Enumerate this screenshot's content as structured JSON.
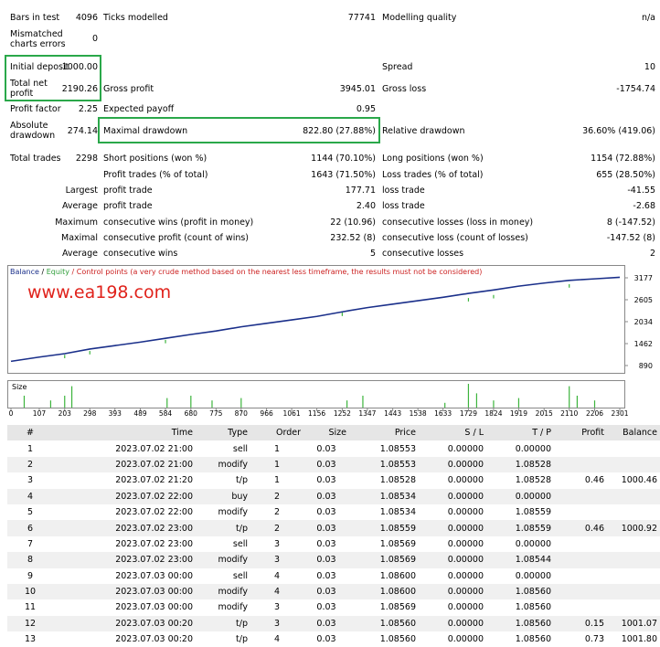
{
  "summary": {
    "bars_in_test_label": "Bars in test",
    "bars_in_test": "4096",
    "ticks_modelled_label": "Ticks modelled",
    "ticks_modelled": "77741",
    "modelling_quality_label": "Modelling quality",
    "modelling_quality": "n/a",
    "mismatched_label_1": "Mismatched",
    "mismatched_label_2": "charts errors",
    "mismatched": "0",
    "initial_deposit_label": "Initial deposit",
    "initial_deposit": "1000.00",
    "spread_label": "Spread",
    "spread": "10",
    "total_net_label_1": "Total net",
    "total_net_label_2": "profit",
    "total_net": "2190.26",
    "gross_profit_label": "Gross profit",
    "gross_profit": "3945.01",
    "gross_loss_label": "Gross loss",
    "gross_loss": "-1754.74",
    "profit_factor_label": "Profit factor",
    "profit_factor": "2.25",
    "expected_payoff_label": "Expected payoff",
    "expected_payoff": "0.95",
    "absolute_dd_label_1": "Absolute",
    "absolute_dd_label_2": "drawdown",
    "absolute_dd": "274.14",
    "maximal_dd_label": "Maximal drawdown",
    "maximal_dd": "822.80 (27.88%)",
    "relative_dd_label": "Relative drawdown",
    "relative_dd": "36.60% (419.06)",
    "total_trades_label": "Total trades",
    "total_trades": "2298",
    "short_label": "Short positions (won %)",
    "short": "1144 (70.10%)",
    "long_label": "Long positions (won %)",
    "long": "1154 (72.88%)",
    "profit_trades_label": "Profit trades (% of total)",
    "profit_trades": "1643 (71.50%)",
    "loss_trades_label": "Loss trades (% of total)",
    "loss_trades": "655 (28.50%)",
    "largest_label": "Largest",
    "largest_profit_label": "profit trade",
    "largest_profit": "177.71",
    "largest_loss_label": "loss trade",
    "largest_loss": "-41.55",
    "average_label": "Average",
    "average_profit_label": "profit trade",
    "average_profit": "2.40",
    "average_loss_label": "loss trade",
    "average_loss": "-2.68",
    "maximum_label": "Maximum",
    "max_cons_wins_label": "consecutive wins (profit in money)",
    "max_cons_wins": "22 (10.96)",
    "max_cons_losses_label": "consecutive losses (loss in money)",
    "max_cons_losses": "8 (-147.52)",
    "maximal_label": "Maximal",
    "max_cons_profit_label": "consecutive profit (count of wins)",
    "max_cons_profit": "232.52 (8)",
    "max_cons_loss_label": "consecutive loss (count of losses)",
    "max_cons_loss": "-147.52 (8)",
    "average2_label": "Average",
    "avg_cons_wins_label": "consecutive wins",
    "avg_cons_wins": "5",
    "avg_cons_losses_label": "consecutive losses",
    "avg_cons_losses": "2"
  },
  "watermark": "www.ea198.com",
  "chart_data": {
    "type": "line",
    "legend_balance": "Balance",
    "legend_sep1": " / ",
    "legend_equity": "Equity",
    "legend_rest": " / Control points (a very crude method based on the nearest less timeframe, the results must not be considered)",
    "size_label": "Size",
    "y_ticks": [
      "3177",
      "2605",
      "2034",
      "1462",
      "890"
    ],
    "y_values": [
      3177,
      2605,
      2034,
      1462,
      890
    ],
    "x_ticks": [
      "0",
      "107",
      "203",
      "298",
      "393",
      "489",
      "584",
      "680",
      "775",
      "870",
      "966",
      "1061",
      "1156",
      "1252",
      "1347",
      "1443",
      "1538",
      "1633",
      "1729",
      "1824",
      "1919",
      "2015",
      "2110",
      "2206",
      "2301"
    ],
    "x_values": [
      0,
      107,
      203,
      298,
      393,
      489,
      584,
      680,
      775,
      870,
      966,
      1061,
      1156,
      1252,
      1347,
      1443,
      1538,
      1633,
      1729,
      1824,
      1919,
      2015,
      2110,
      2206,
      2301
    ],
    "balance": [
      [
        0,
        1000
      ],
      [
        107,
        1110
      ],
      [
        203,
        1200
      ],
      [
        298,
        1320
      ],
      [
        393,
        1410
      ],
      [
        489,
        1500
      ],
      [
        584,
        1600
      ],
      [
        680,
        1700
      ],
      [
        775,
        1790
      ],
      [
        870,
        1900
      ],
      [
        966,
        1990
      ],
      [
        1061,
        2080
      ],
      [
        1156,
        2170
      ],
      [
        1252,
        2290
      ],
      [
        1347,
        2400
      ],
      [
        1443,
        2490
      ],
      [
        1538,
        2580
      ],
      [
        1633,
        2670
      ],
      [
        1729,
        2770
      ],
      [
        1824,
        2860
      ],
      [
        1919,
        2960
      ],
      [
        2015,
        3040
      ],
      [
        2110,
        3110
      ],
      [
        2206,
        3150
      ],
      [
        2301,
        3190
      ]
    ],
    "equity_dips": [
      [
        203,
        1080
      ],
      [
        298,
        1180
      ],
      [
        584,
        1470
      ],
      [
        1252,
        2180
      ],
      [
        1729,
        2560
      ],
      [
        1824,
        2640
      ],
      [
        2110,
        2920
      ]
    ],
    "size_bars": [
      [
        50,
        0.5
      ],
      [
        150,
        0.3
      ],
      [
        203,
        0.5
      ],
      [
        230,
        0.9
      ],
      [
        590,
        0.4
      ],
      [
        680,
        0.5
      ],
      [
        760,
        0.3
      ],
      [
        870,
        0.4
      ],
      [
        1270,
        0.3
      ],
      [
        1330,
        0.5
      ],
      [
        1640,
        0.2
      ],
      [
        1729,
        1.0
      ],
      [
        1760,
        0.6
      ],
      [
        1824,
        0.3
      ],
      [
        1919,
        0.4
      ],
      [
        2110,
        0.9
      ],
      [
        2140,
        0.5
      ],
      [
        2206,
        0.3
      ]
    ]
  },
  "trades": {
    "headers": [
      "#",
      "Time",
      "Type",
      "Order",
      "Size",
      "Price",
      "S / L",
      "T / P",
      "Profit",
      "Balance"
    ],
    "rows": [
      [
        "1",
        "2023.07.02 21:00",
        "sell",
        "1",
        "0.03",
        "1.08553",
        "0.00000",
        "0.00000",
        "",
        ""
      ],
      [
        "2",
        "2023.07.02 21:00",
        "modify",
        "1",
        "0.03",
        "1.08553",
        "0.00000",
        "1.08528",
        "",
        ""
      ],
      [
        "3",
        "2023.07.02 21:20",
        "t/p",
        "1",
        "0.03",
        "1.08528",
        "0.00000",
        "1.08528",
        "0.46",
        "1000.46"
      ],
      [
        "4",
        "2023.07.02 22:00",
        "buy",
        "2",
        "0.03",
        "1.08534",
        "0.00000",
        "0.00000",
        "",
        ""
      ],
      [
        "5",
        "2023.07.02 22:00",
        "modify",
        "2",
        "0.03",
        "1.08534",
        "0.00000",
        "1.08559",
        "",
        ""
      ],
      [
        "6",
        "2023.07.02 23:00",
        "t/p",
        "2",
        "0.03",
        "1.08559",
        "0.00000",
        "1.08559",
        "0.46",
        "1000.92"
      ],
      [
        "7",
        "2023.07.02 23:00",
        "sell",
        "3",
        "0.03",
        "1.08569",
        "0.00000",
        "0.00000",
        "",
        ""
      ],
      [
        "8",
        "2023.07.02 23:00",
        "modify",
        "3",
        "0.03",
        "1.08569",
        "0.00000",
        "1.08544",
        "",
        ""
      ],
      [
        "9",
        "2023.07.03 00:00",
        "sell",
        "4",
        "0.03",
        "1.08600",
        "0.00000",
        "0.00000",
        "",
        ""
      ],
      [
        "10",
        "2023.07.03 00:00",
        "modify",
        "4",
        "0.03",
        "1.08600",
        "0.00000",
        "1.08560",
        "",
        ""
      ],
      [
        "11",
        "2023.07.03 00:00",
        "modify",
        "3",
        "0.03",
        "1.08569",
        "0.00000",
        "1.08560",
        "",
        ""
      ],
      [
        "12",
        "2023.07.03 00:20",
        "t/p",
        "3",
        "0.03",
        "1.08560",
        "0.00000",
        "1.08560",
        "0.15",
        "1001.07"
      ],
      [
        "13",
        "2023.07.03 00:20",
        "t/p",
        "4",
        "0.03",
        "1.08560",
        "0.00000",
        "1.08560",
        "0.73",
        "1001.80"
      ]
    ]
  }
}
